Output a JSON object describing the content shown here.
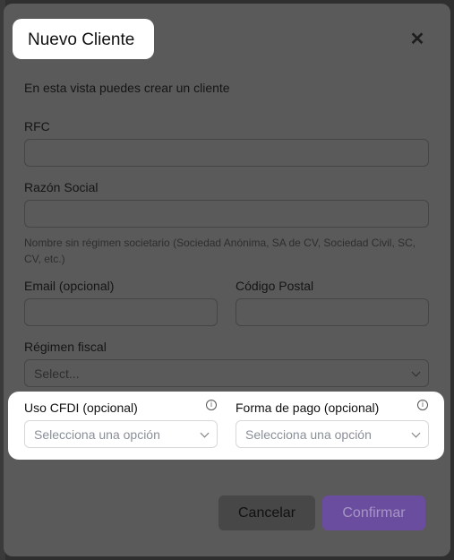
{
  "modal": {
    "title": "Nuevo Cliente",
    "subtitle": "En esta vista puedes crear un cliente"
  },
  "fields": {
    "rfc": {
      "label": "RFC",
      "value": ""
    },
    "razon_social": {
      "label": "Razón Social",
      "value": "",
      "hint": "Nombre sin régimen societario (Sociedad Anónima, SA de CV, Sociedad Civil, SC, CV, etc.)"
    },
    "email": {
      "label": "Email (opcional)",
      "value": ""
    },
    "codigo_postal": {
      "label": "Código Postal",
      "value": ""
    },
    "regimen_fiscal": {
      "label": "Régimen fiscal",
      "selected": "Select..."
    },
    "uso_cfdi": {
      "label": "Uso CFDI (opcional)",
      "selected": "Selecciona una opción"
    },
    "forma_pago": {
      "label": "Forma de pago (opcional)",
      "selected": "Selecciona una opción"
    }
  },
  "actions": {
    "cancel_label": "Cancelar",
    "confirm_label": "Confirmar"
  },
  "icons": {
    "close": "close-icon",
    "info": "info-icon",
    "chevron": "chevron-down-icon"
  },
  "colors": {
    "overlay": "#5a5a5a",
    "confirm": "#6b4d9f",
    "highlight": "#ffffff"
  }
}
